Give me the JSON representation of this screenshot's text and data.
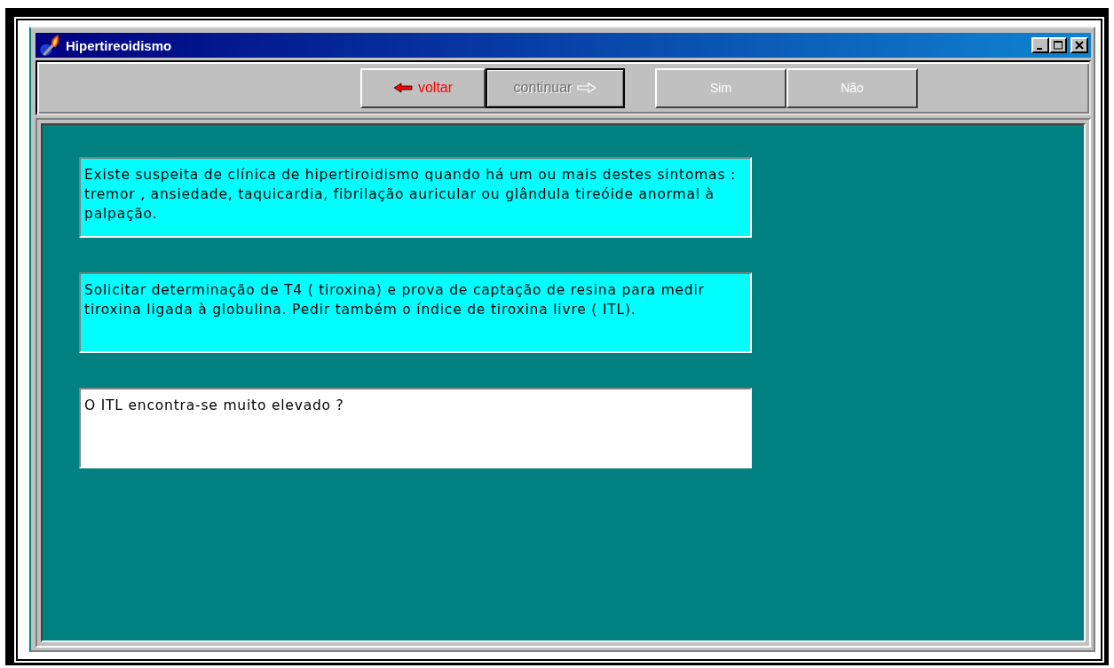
{
  "window": {
    "title": "Hipertireoidismo"
  },
  "toolbar": {
    "buttons": [
      {
        "label": "voltar",
        "kind": "back",
        "disabled": false,
        "focused": false
      },
      {
        "label": "continuar",
        "kind": "forward",
        "disabled": true,
        "focused": true
      },
      {
        "label": "Sim",
        "kind": "answer",
        "disabled": true,
        "focused": false
      },
      {
        "label": "Não",
        "kind": "answer",
        "disabled": true,
        "focused": false
      }
    ]
  },
  "messages": [
    {
      "kind": "info",
      "text": "Existe suspeita de clínica de hipertiroidismo quando há um ou mais destes sintomas : tremor , ansiedade, taquicardia, fibrilação auricular ou glândula tireóide anormal à palpação."
    },
    {
      "kind": "info",
      "text": "Solicitar determinação de T4 ( tiroxina) e prova de captação de resina para medir tiroxina ligada à globulina. Pedir também o índice de tiroxina livre ( ITL)."
    },
    {
      "kind": "question",
      "text": "O ITL encontra-se muito elevado ?"
    }
  ]
}
